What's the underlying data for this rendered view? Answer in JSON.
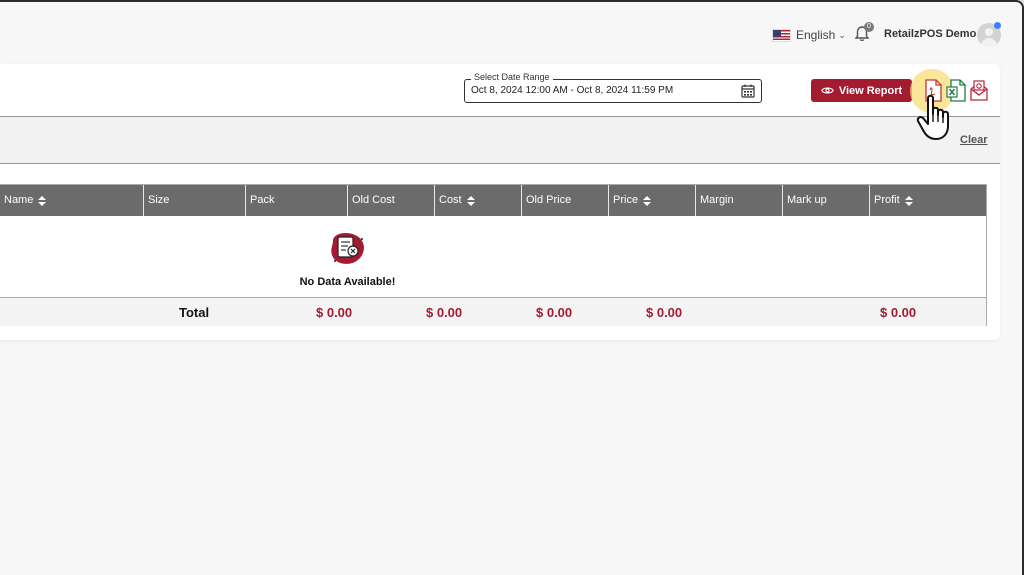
{
  "header": {
    "language": "English",
    "notification_count": "0",
    "user_name": "RetailzPOS Demo"
  },
  "filters": {
    "date_range_label": "Select Date Range",
    "date_range_value": "Oct 8, 2024 12:00 AM - Oct 8, 2024 11:59 PM",
    "view_report_label": "View Report",
    "clear_label": "Clear"
  },
  "table": {
    "columns": [
      {
        "label": "Name",
        "sortable": true
      },
      {
        "label": "Size",
        "sortable": false
      },
      {
        "label": "Pack",
        "sortable": false
      },
      {
        "label": "Old Cost",
        "sortable": false
      },
      {
        "label": "Cost",
        "sortable": true
      },
      {
        "label": "Old Price",
        "sortable": false
      },
      {
        "label": "Price",
        "sortable": true
      },
      {
        "label": "Margin",
        "sortable": false
      },
      {
        "label": "Mark up",
        "sortable": false
      },
      {
        "label": "Profit",
        "sortable": true
      }
    ],
    "empty_message": "No Data Available!",
    "totals": {
      "label": "Total",
      "old_cost": "$ 0.00",
      "cost": "$ 0.00",
      "old_price": "$ 0.00",
      "price": "$ 0.00",
      "profit": "$ 0.00"
    }
  },
  "colors": {
    "brand": "#a31b31",
    "header_bg": "#6b6b6b",
    "highlight": "#fadc78"
  },
  "icons": {
    "pdf": "pdf-export-icon",
    "excel": "excel-export-icon",
    "email": "email-export-icon",
    "calendar": "calendar-icon",
    "bell": "bell-icon",
    "eye": "eye-icon",
    "cursor": "hand-pointer-icon",
    "empty": "no-data-icon"
  }
}
